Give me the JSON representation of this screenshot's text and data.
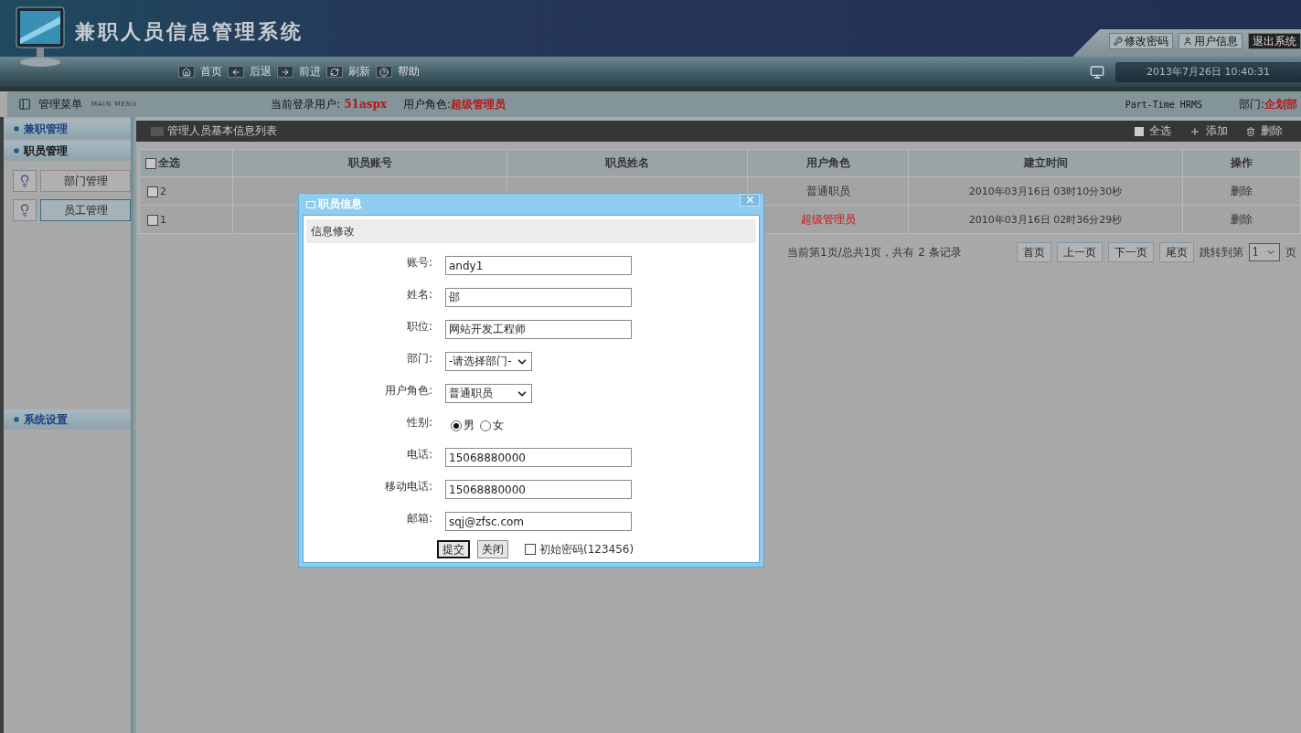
{
  "header": {
    "title": "兼职人员信息管理系统",
    "links": [
      {
        "kind": "key",
        "label": "修改密码"
      },
      {
        "kind": "user",
        "label": "用户信息"
      },
      {
        "kind": "exit",
        "label": "退出系统"
      }
    ],
    "nav": [
      {
        "kind": "home",
        "label": "首页"
      },
      {
        "kind": "back",
        "label": "后退"
      },
      {
        "kind": "forward",
        "label": "前进"
      },
      {
        "kind": "refresh",
        "label": "刷新"
      },
      {
        "kind": "help",
        "label": "帮助"
      }
    ],
    "datetime": "2013年7月26日 10:40:31"
  },
  "infobar": {
    "menu_title": "管理菜单",
    "menu_subtitle": "MAIN MENU",
    "user_label": "当前登录用户:",
    "user": "51aspx",
    "role_label": "用户角色:",
    "role": "超级管理员",
    "system": "Part-Time HRMS",
    "dept_label": "部门:",
    "dept": "企划部"
  },
  "sidebar": {
    "sections": [
      {
        "title": "兼职管理",
        "expanded": false
      },
      {
        "title": "职员管理",
        "expanded": true,
        "items": [
          {
            "label": "部门管理",
            "selected": false
          },
          {
            "label": "员工管理",
            "selected": true
          }
        ]
      }
    ],
    "footer_section": {
      "title": "系统设置",
      "expanded": false
    }
  },
  "list": {
    "title": "管理人员基本信息列表",
    "actions": [
      {
        "kind": "select",
        "label": "全选"
      },
      {
        "kind": "add",
        "label": "添加"
      },
      {
        "kind": "delete",
        "label": "删除"
      }
    ],
    "select_all": {
      "label": "全选",
      "checked": false
    },
    "columns": [
      "职员账号",
      "职员姓名",
      "用户角色",
      "建立时间",
      "操作"
    ],
    "rows": [
      {
        "id": "2",
        "checked": false,
        "role": "普通职员",
        "highlighted": false,
        "created": "2010年03月16日  03时10分30秒",
        "action": "删除"
      },
      {
        "id": "1",
        "checked": false,
        "role": "超级管理员",
        "highlighted": true,
        "created": "2010年03月16日  02时36分29秒",
        "action": "删除"
      }
    ],
    "pagination": {
      "info": "当前第1页/总共1页，共有 2 条记录",
      "buttons": [
        "首页",
        "上一页",
        "下一页",
        "尾页"
      ],
      "jump_label": "跳转到第",
      "page": "1",
      "suffix": "页"
    }
  },
  "dialog": {
    "title": "职员信息",
    "section": "信息修改",
    "fields": [
      {
        "kind": "text",
        "label": "账号:",
        "value": "andy1"
      },
      {
        "kind": "text",
        "label": "姓名:",
        "value": "邵"
      },
      {
        "kind": "text",
        "label": "职位:",
        "value": "网站开发工程师"
      },
      {
        "kind": "select",
        "label": "部门:",
        "value": "-请选择部门-"
      },
      {
        "kind": "select",
        "label": "用户角色:",
        "value": "普通职员"
      },
      {
        "kind": "radio",
        "label": "性别:",
        "options": [
          {
            "label": "男",
            "selected": true
          },
          {
            "label": "女",
            "selected": false
          }
        ]
      },
      {
        "kind": "text",
        "label": "电话:",
        "value": "15068880000"
      },
      {
        "kind": "text",
        "label": "移动电话:",
        "value": "15068880000"
      },
      {
        "kind": "text",
        "label": "邮箱:",
        "value": "sqj@zfsc.com"
      }
    ],
    "buttons": [
      {
        "label": "提交",
        "primary": true
      },
      {
        "label": "关闭",
        "primary": false
      }
    ],
    "reset_option": {
      "label": "初始密码(123456)",
      "checked": false
    }
  }
}
